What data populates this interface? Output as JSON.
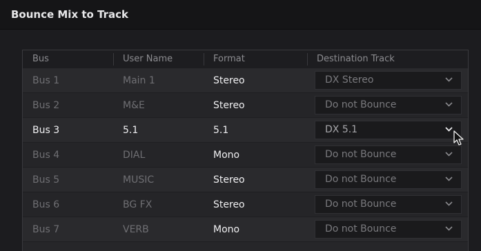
{
  "dialog": {
    "title": "Bounce Mix to Track"
  },
  "table": {
    "headers": {
      "bus": "Bus",
      "user_name": "User Name",
      "format": "Format",
      "destination": "Destination Track"
    },
    "rows": [
      {
        "bus": "Bus 1",
        "user_name": "Main 1",
        "format": "Stereo",
        "destination": "DX Stereo"
      },
      {
        "bus": "Bus 2",
        "user_name": "M&E",
        "format": "Stereo",
        "destination": "Do not Bounce"
      },
      {
        "bus": "Bus 3",
        "user_name": "5.1",
        "format": "5.1",
        "destination": "DX 5.1"
      },
      {
        "bus": "Bus 4",
        "user_name": "DIAL",
        "format": "Mono",
        "destination": "Do not Bounce"
      },
      {
        "bus": "Bus 5",
        "user_name": "MUSIC",
        "format": "Stereo",
        "destination": "Do not Bounce"
      },
      {
        "bus": "Bus 6",
        "user_name": "BG FX",
        "format": "Stereo",
        "destination": "Do not Bounce"
      },
      {
        "bus": "Bus 7",
        "user_name": "VERB",
        "format": "Mono",
        "destination": "Do not Bounce"
      }
    ]
  }
}
